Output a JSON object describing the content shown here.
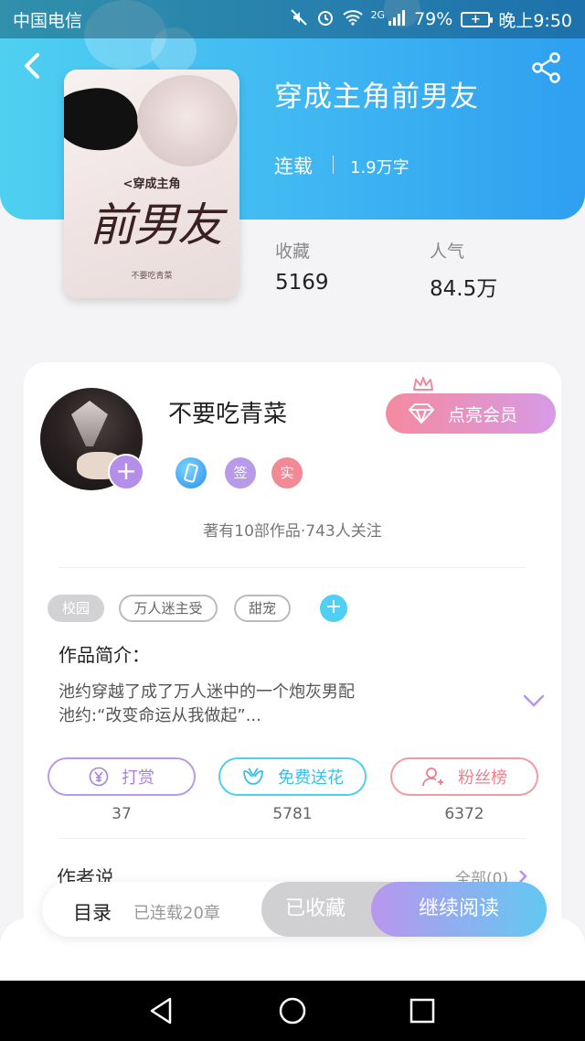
{
  "status_bar": {
    "carrier": "中国电信",
    "network": "2G",
    "battery_percent": "79%",
    "time": "晚上9:50"
  },
  "book": {
    "title": "穿成主角前男友",
    "status": "连载",
    "word_count": "1.9万字",
    "cover": {
      "subtitle": "<穿成主角",
      "main_title": "前男友",
      "author": "不要吃青菜"
    },
    "stats": [
      {
        "label": "收藏",
        "value": "5169"
      },
      {
        "label": "人气",
        "value": "84.5万"
      }
    ]
  },
  "author": {
    "name": "不要吃青菜",
    "vip_label": "点亮会员",
    "badges": [
      {
        "label": "签"
      },
      {
        "label": "实"
      }
    ],
    "meta": "著有10部作品·743人关注"
  },
  "tags": [
    {
      "label": "校园"
    },
    {
      "label": "万人迷主受"
    },
    {
      "label": "甜宠"
    }
  ],
  "synopsis": {
    "label": "作品简介：",
    "lines": [
      "池约穿越了成了万人迷中的一个炮灰男配",
      "池约:“改变命运从我做起”..."
    ]
  },
  "actions": [
    {
      "label": "打赏",
      "count": "37"
    },
    {
      "label": "免费送花",
      "count": "5781"
    },
    {
      "label": "粉丝榜",
      "count": "6372"
    }
  ],
  "author_say": {
    "label": "作者说",
    "all_link": "全部(0)"
  },
  "bottom_bar": {
    "toc_label": "目录",
    "chapters_label": "已连载20章",
    "collected_label": "已收藏",
    "continue_label": "继续阅读"
  },
  "colors": {
    "header_gradient_start": "#4fd0f0",
    "header_gradient_end": "#2f9ff0",
    "vip_start": "#f58aa0",
    "vip_end": "#d79ae6",
    "continue_start": "#b996ee",
    "continue_end": "#62c8f2"
  },
  "icons": {
    "back": "back-arrow-icon",
    "share": "share-icon",
    "vip": "diamond-icon",
    "reward": "yen-icon",
    "flower": "flower-icon",
    "fans": "user-icon"
  }
}
